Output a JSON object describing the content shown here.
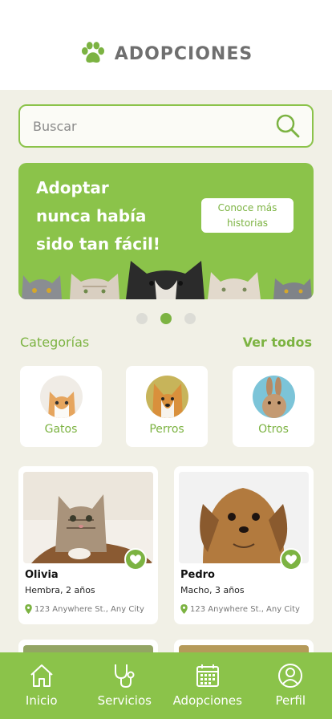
{
  "header": {
    "title": "ADOPCIONES"
  },
  "search": {
    "placeholder": "Buscar"
  },
  "banner": {
    "line1": "Adoptar",
    "line2": "nunca había",
    "line3": "sido tan fácil!",
    "cta_line1": "Conoce más",
    "cta_line2": "historias"
  },
  "carousel": {
    "active_index": 1,
    "count": 3
  },
  "categories": {
    "title": "Categorías",
    "see_all": "Ver todos",
    "items": [
      {
        "label": "Gatos"
      },
      {
        "label": "Perros"
      },
      {
        "label": "Otros"
      }
    ]
  },
  "pets": [
    {
      "name": "Olivia",
      "desc": "Hembra, 2 años",
      "location": "123 Anywhere St., Any City"
    },
    {
      "name": "Pedro",
      "desc": "Macho, 3 años",
      "location": "123 Anywhere St., Any City"
    }
  ],
  "tabbar": {
    "items": [
      {
        "label": "Inicio",
        "icon": "home-icon"
      },
      {
        "label": "Servicios",
        "icon": "stethoscope-icon"
      },
      {
        "label": "Adopciones",
        "icon": "calendar-icon"
      },
      {
        "label": "Perfil",
        "icon": "user-icon"
      }
    ]
  },
  "colors": {
    "accent": "#8bc34a",
    "accent_dark": "#7cb342",
    "background": "#f1f0e6"
  }
}
